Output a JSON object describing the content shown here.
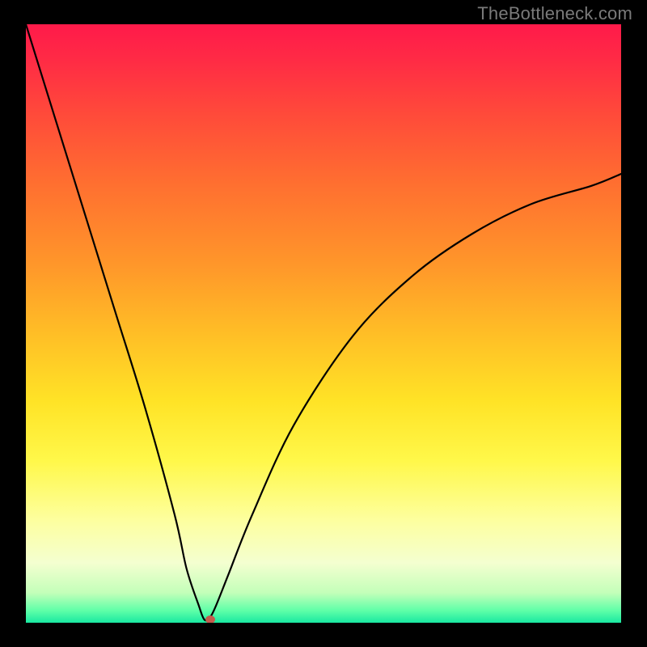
{
  "watermark": "TheBottleneck.com",
  "chart_data": {
    "type": "line",
    "title": "",
    "xlabel": "",
    "ylabel": "",
    "xlim": [
      0,
      100
    ],
    "ylim": [
      0,
      100
    ],
    "series": [
      {
        "name": "bottleneck-curve",
        "x": [
          0,
          5,
          10,
          15,
          20,
          25,
          27,
          29,
          30,
          31,
          32,
          34,
          38,
          45,
          55,
          65,
          75,
          85,
          95,
          100
        ],
        "values": [
          100,
          84,
          68,
          52,
          36,
          18,
          9,
          3,
          0.5,
          1,
          3,
          8,
          18,
          33,
          48,
          58,
          65,
          70,
          73,
          75
        ]
      }
    ],
    "marker": {
      "x": 31,
      "y": 0.5
    },
    "background_gradient": {
      "top": "#ff1a4a",
      "bottom": "#19e8a1"
    }
  }
}
